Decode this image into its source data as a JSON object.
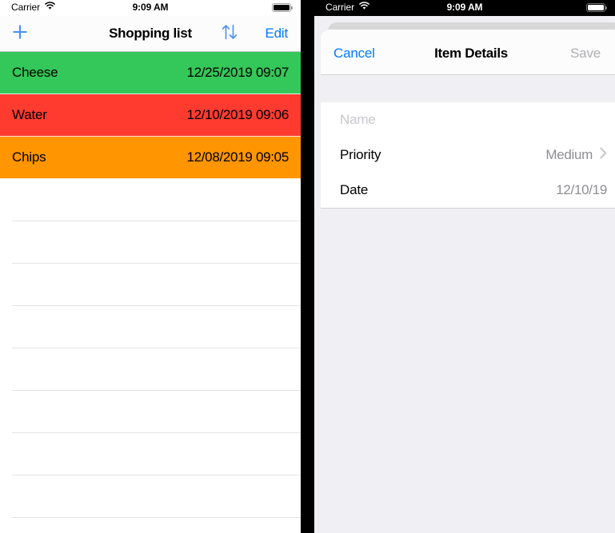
{
  "left_phone": {
    "status_bar": {
      "carrier": "Carrier",
      "wifi_icon": "wifi-icon",
      "time": "9:09 AM",
      "battery_icon": "battery-full-icon"
    },
    "nav_bar": {
      "add_label": "+",
      "add_icon": "plus-icon",
      "title": "Shopping list",
      "sort_icon": "sort-arrows-icon",
      "edit_label": "Edit"
    },
    "items": [
      {
        "name": "Cheese",
        "date": "12/25/2019 09:07",
        "color": "#34C759"
      },
      {
        "name": "Water",
        "date": "12/10/2019 09:06",
        "color": "#FF3B30"
      },
      {
        "name": "Chips",
        "date": "12/08/2019 09:05",
        "color": "#FF9500"
      }
    ],
    "empty_row_count": 8
  },
  "right_phone": {
    "status_bar": {
      "carrier": "Carrier",
      "wifi_icon": "wifi-icon",
      "time": "9:09 AM",
      "battery_icon": "battery-full-icon"
    },
    "sheet": {
      "cancel_label": "Cancel",
      "title": "Item Details",
      "save_label": "Save",
      "form": {
        "name": {
          "label": "Name",
          "value": "",
          "placeholder": "Name"
        },
        "priority": {
          "label": "Priority",
          "value": "Medium",
          "chevron_icon": "chevron-right-icon"
        },
        "date": {
          "label": "Date",
          "value": "12/10/19"
        }
      }
    }
  },
  "colors": {
    "accent_blue": "#007AFF",
    "green": "#34C759",
    "red": "#FF3B30",
    "orange": "#FF9500",
    "disabled_gray": "#AEAEB2",
    "group_bg": "#EFEFF4"
  }
}
